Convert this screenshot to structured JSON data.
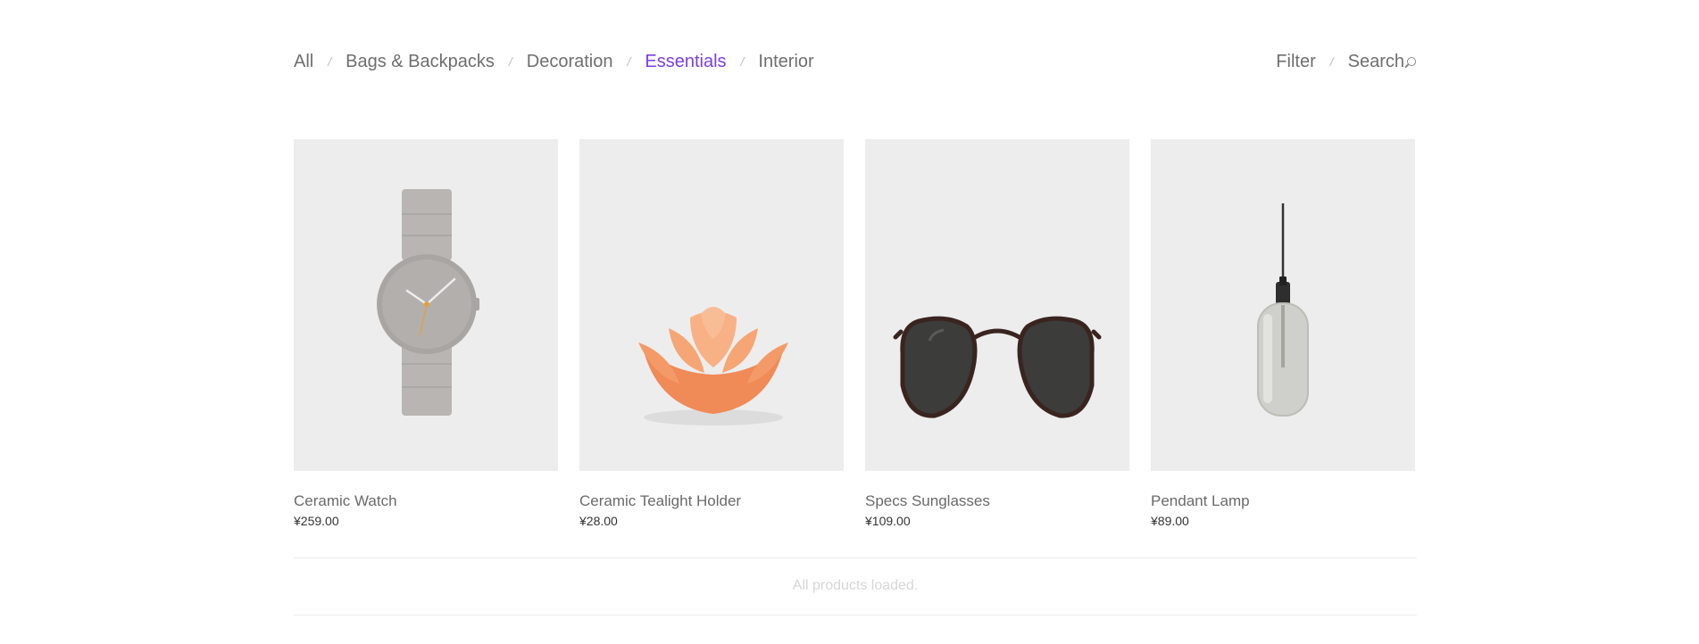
{
  "nav": {
    "categories": [
      "All",
      "Bags & Backpacks",
      "Decoration",
      "Essentials",
      "Interior"
    ],
    "active": "Essentials",
    "separator": "/",
    "tools": {
      "filter": "Filter",
      "search": "Search"
    }
  },
  "products": [
    {
      "name": "Ceramic Watch",
      "price": "¥259.00",
      "image_icon": "watch-icon"
    },
    {
      "name": "Ceramic Tealight Holder",
      "price": "¥28.00",
      "image_icon": "lotus-tealight-icon"
    },
    {
      "name": "Specs Sunglasses",
      "price": "¥109.00",
      "image_icon": "sunglasses-icon"
    },
    {
      "name": "Pendant Lamp",
      "price": "¥89.00",
      "image_icon": "pendant-lamp-icon"
    }
  ],
  "footer": {
    "status": "All products loaded."
  },
  "colors": {
    "accent": "#7b3fe4",
    "thumb_bg": "#ededed"
  }
}
